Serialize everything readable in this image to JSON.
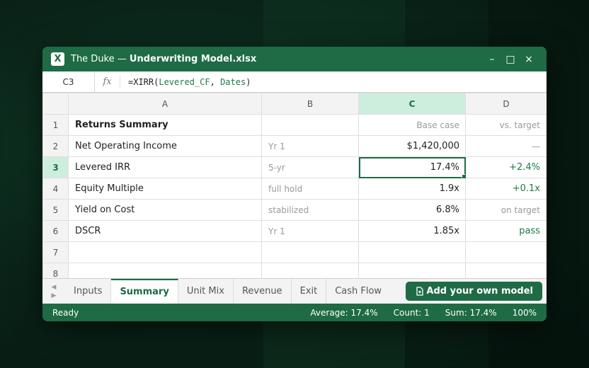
{
  "window": {
    "title_prefix": "The Duke — ",
    "title_file": "Underwriting Model.xlsx",
    "app_icon_letter": "X",
    "minimize": "–",
    "maximize": "□",
    "close": "×"
  },
  "formula_bar": {
    "cell_ref": "C3",
    "fx_label": "fx",
    "formula_prefix": "=XIRR(",
    "arg1": "Levered_CF",
    "sep": ", ",
    "arg2": "Dates",
    "formula_suffix": ")"
  },
  "columns": [
    "A",
    "B",
    "C",
    "D"
  ],
  "rows": [
    {
      "num": "1",
      "a": "Returns Summary",
      "b": "",
      "c": "Base case",
      "d": "vs. target"
    },
    {
      "num": "2",
      "a": "Net Operating Income",
      "b": "Yr 1",
      "c": "$1,420,000",
      "d": "—"
    },
    {
      "num": "3",
      "a": "Levered IRR",
      "b": "5-yr",
      "c": "17.4%",
      "d": "+2.4%"
    },
    {
      "num": "4",
      "a": "Equity Multiple",
      "b": "full hold",
      "c": "1.9x",
      "d": "+0.1x"
    },
    {
      "num": "5",
      "a": "Yield on Cost",
      "b": "stabilized",
      "c": "6.8%",
      "d": "on target"
    },
    {
      "num": "6",
      "a": "DSCR",
      "b": "Yr 1",
      "c": "1.85x",
      "d": "pass"
    },
    {
      "num": "7",
      "a": "",
      "b": "",
      "c": "",
      "d": ""
    },
    {
      "num": "8",
      "a": "",
      "b": "",
      "c": "",
      "d": ""
    }
  ],
  "tabs": {
    "nav_prev": "◀",
    "nav_next": "▶",
    "items": [
      "Inputs",
      "Summary",
      "Unit Mix",
      "Revenue",
      "Exit",
      "Cash Flow"
    ],
    "active": "Summary",
    "add_button": "Add your own model"
  },
  "status": {
    "ready": "Ready",
    "average": "Average: 17.4%",
    "count": "Count: 1",
    "sum": "Sum: 17.4%",
    "zoom": "100%"
  },
  "colors": {
    "brand": "#1e6b45",
    "positive": "#1e7a4a",
    "selected_header": "#cdeedc"
  }
}
